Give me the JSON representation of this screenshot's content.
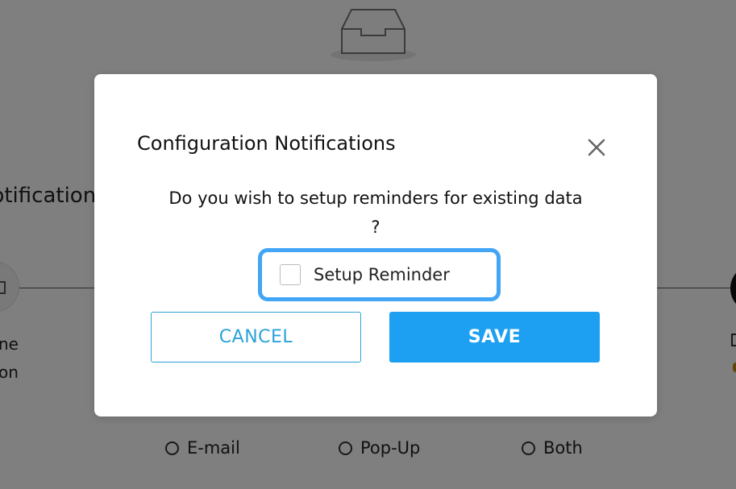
{
  "background": {
    "heading": "Notifications",
    "step_left_label": "ne\non",
    "radio_options": [
      {
        "label": "E-mail"
      },
      {
        "label": "Pop-Up"
      },
      {
        "label": "Both"
      }
    ]
  },
  "modal": {
    "title": "Configuration Notifications",
    "message": "Do you wish to setup reminders for existing data ?",
    "checkbox_label": "Setup Reminder",
    "checkbox_checked": false,
    "cancel_label": "CANCEL",
    "save_label": "SAVE",
    "close_icon": "close-icon"
  },
  "colors": {
    "accent": "#1ea0f2",
    "accent_outline": "#29a3d8",
    "focus_ring": "#42a5f5",
    "overlay": "rgba(0,0,0,0.5)"
  }
}
